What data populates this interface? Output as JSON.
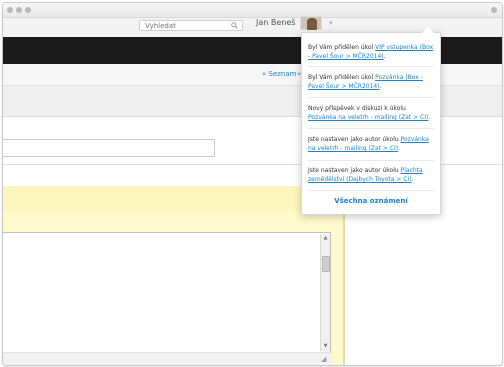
{
  "header": {
    "search_placeholder": "Vyhledat",
    "user_name": "Jan Beneš"
  },
  "nav": {
    "back_link": "« Seznam",
    "next_link": "»"
  },
  "notifications": {
    "items": [
      {
        "prefix": "Byl Vám přidělen úkol ",
        "link": "VIP vstupenka (Box - Pavel Šour > MČR2014)",
        "suffix": "."
      },
      {
        "prefix": "Byl Vám přidělen úkol ",
        "link": "Pozvánka (Box - Pavel Šour > MČR2014)",
        "suffix": "."
      },
      {
        "prefix": "Nový příspěvek v diskuzi k úkolu ",
        "link": "Pozvánka na veletrh - mailing (Zat > CI)",
        "suffix": "."
      },
      {
        "prefix": "Jste nastaven jako autor úkolu ",
        "link": "Pozvánka na veletrh - mailing (Zat > CI)",
        "suffix": "."
      },
      {
        "prefix": "Jste nastaven jako autor úkolu ",
        "link": "Plachta zemědělství (Dajbych Toyota > CI)",
        "suffix": "."
      }
    ],
    "all_label": "Všechna oznámení"
  },
  "colors": {
    "link": "#1f83c6",
    "dark_bar": "#1b1b1b",
    "highlight": "#fffacd"
  }
}
